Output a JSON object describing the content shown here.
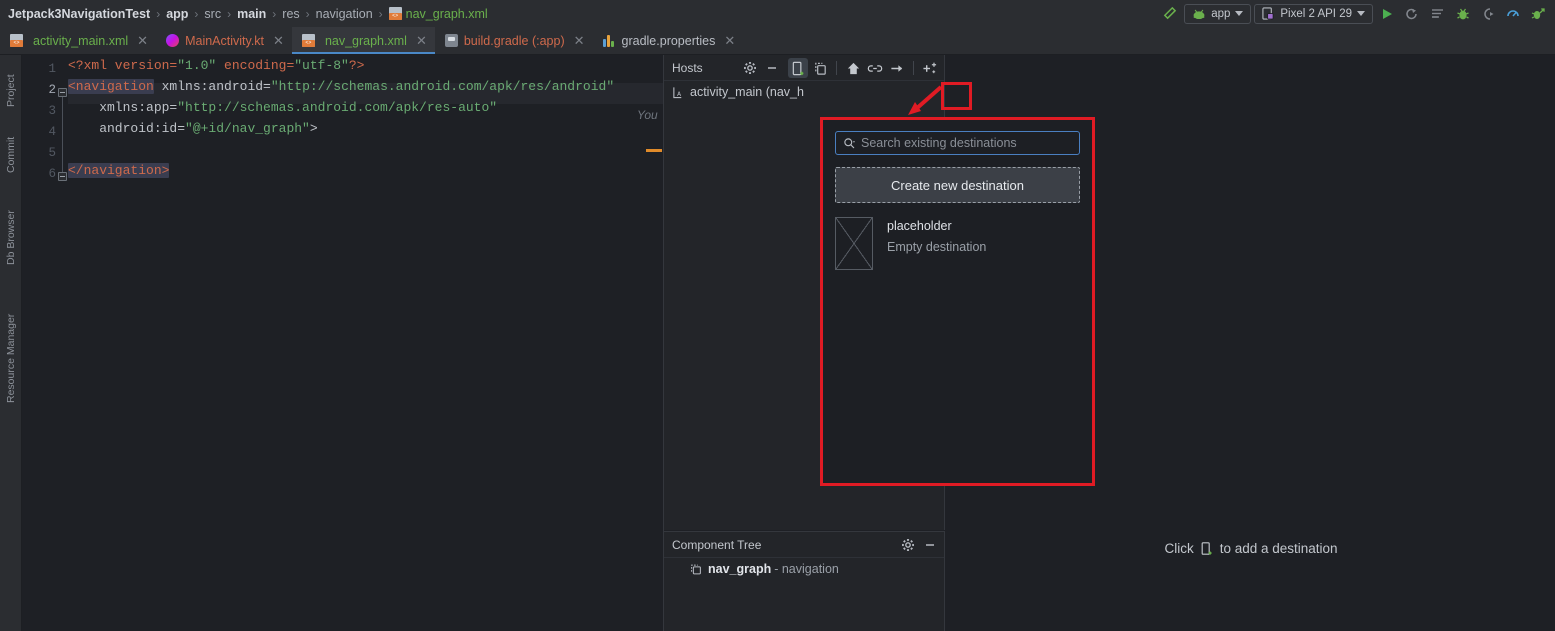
{
  "breadcrumb": {
    "items": [
      {
        "label": "Jetpack3NavigationTest",
        "style": "bold"
      },
      {
        "label": "app",
        "style": "bold"
      },
      {
        "label": "src",
        "style": "normal"
      },
      {
        "label": "main",
        "style": "bold"
      },
      {
        "label": "res",
        "style": "normal"
      },
      {
        "label": "navigation",
        "style": "normal"
      },
      {
        "label": "nav_graph.xml",
        "style": "file"
      }
    ],
    "separator": "›"
  },
  "toolbar": {
    "build_icon": "hammer-icon",
    "run_config": "app",
    "device": "Pixel 2 API 29",
    "run_icon": "run-icon",
    "rerun_icon": "rerun-icon",
    "logcat_icon": "logcat-icon",
    "debug_icon": "debug-icon",
    "attach_icon": "attach-debugger-icon",
    "profiler_icon": "profiler-icon",
    "apply_icon": "apply-changes-icon"
  },
  "tabs": [
    {
      "label": "activity_main.xml",
      "icon": "xml-layout-icon",
      "color": "green",
      "active": false,
      "closable": true
    },
    {
      "label": "MainActivity.kt",
      "icon": "kotlin-icon",
      "color": "red",
      "active": false,
      "closable": true
    },
    {
      "label": "nav_graph.xml",
      "icon": "xml-layout-icon",
      "color": "green",
      "active": true,
      "closable": true
    },
    {
      "label": "build.gradle (:app)",
      "icon": "gradle-icon",
      "color": "red",
      "active": false,
      "closable": true
    },
    {
      "label": "gradle.properties",
      "icon": "properties-icon",
      "color": "gray",
      "active": false,
      "closable": true
    }
  ],
  "left_strip": [
    {
      "label": "Project",
      "icon": "project-icon"
    },
    {
      "label": "Commit",
      "icon": "commit-icon"
    },
    {
      "label": "Db Browser",
      "icon": "db-browser-icon"
    },
    {
      "label": "Resource Manager",
      "icon": "resource-manager-icon"
    }
  ],
  "editor": {
    "line_numbers": [
      "1",
      "2",
      "3",
      "4",
      "5",
      "6"
    ],
    "current_line": 2,
    "lines": [
      {
        "n": 1,
        "segments": [
          {
            "t": "<?xml version=",
            "c": "pi"
          },
          {
            "t": "\"1.0\"",
            "c": "str"
          },
          {
            "t": " encoding=",
            "c": "pi"
          },
          {
            "t": "\"utf-8\"",
            "c": "str"
          },
          {
            "t": "?>",
            "c": "pi"
          }
        ]
      },
      {
        "n": 2,
        "segments": [
          {
            "t": "<navigation",
            "c": "tag-sel"
          },
          {
            "t": " xmlns:android=",
            "c": "attr"
          },
          {
            "t": "\"http://schemas.android.com/apk/res/android\"",
            "c": "str"
          }
        ]
      },
      {
        "n": 3,
        "segments": [
          {
            "t": "    xmlns:app=",
            "c": "attr"
          },
          {
            "t": "\"http://schemas.android.com/apk/res-auto\"",
            "c": "str"
          }
        ]
      },
      {
        "n": 4,
        "segments": [
          {
            "t": "    android:id=",
            "c": "attr"
          },
          {
            "t": "\"@+id/nav_graph\"",
            "c": "str"
          },
          {
            "t": ">",
            "c": "punct"
          }
        ]
      },
      {
        "n": 5,
        "segments": []
      },
      {
        "n": 6,
        "segments": [
          {
            "t": "</navigation>",
            "c": "tag-sel"
          }
        ]
      }
    ],
    "warning_count": "1",
    "warning_icon": "warning-triangle-icon",
    "prev_icon": "chevron-up-icon",
    "next_icon": "chevron-down-icon",
    "inlay_hint": "You"
  },
  "hosts_panel": {
    "title": "Hosts",
    "gear_icon": "gear-icon",
    "actions": [
      {
        "name": "new-destination-button",
        "icon": "new-destination-icon",
        "selected": true
      },
      {
        "name": "new-nested-graph-button",
        "icon": "nested-graph-icon",
        "selected": false
      },
      {
        "name": "set-start-destination-button",
        "icon": "home-icon",
        "selected": false
      },
      {
        "name": "new-action-button",
        "icon": "link-icon",
        "selected": false
      },
      {
        "name": "new-deep-link-button",
        "icon": "arrow-right-icon",
        "selected": false
      },
      {
        "name": "auto-arrange-button",
        "icon": "auto-arrange-icon",
        "selected": false
      }
    ],
    "rows": [
      {
        "label": "activity_main (nav_h",
        "icon": "activity-icon"
      }
    ]
  },
  "component_tree": {
    "title": "Component Tree",
    "gear_icon": "gear-icon",
    "minimize_icon": "minimize-icon",
    "nodes": [
      {
        "icon": "navigation-graph-icon",
        "name": "nav_graph",
        "type": " - navigation"
      }
    ]
  },
  "canvas": {
    "hint_prefix": "Click",
    "hint_icon": "new-destination-icon",
    "hint_suffix": "to add a destination"
  },
  "popup": {
    "search_placeholder": "Search existing destinations",
    "search_icon": "search-icon",
    "search_value": "",
    "create_button": "Create new destination",
    "items": [
      {
        "name": "placeholder",
        "subtitle": "Empty destination",
        "thumb": "empty-destination-thumbnail"
      }
    ]
  },
  "annotations": {
    "highlight_color": "#e01b24",
    "arrow": "red-arrow-pointing-to-new-destination-button",
    "box": "red-box-around-new-destination-button"
  },
  "colors": {
    "accent_blue": "#4a88c7",
    "green": "#6ab04c",
    "red": "#cf6a4c",
    "warning": "#e8a33d",
    "bg": "#1e2025",
    "panel_bg": "#232529",
    "chrome": "#2b2d31"
  }
}
